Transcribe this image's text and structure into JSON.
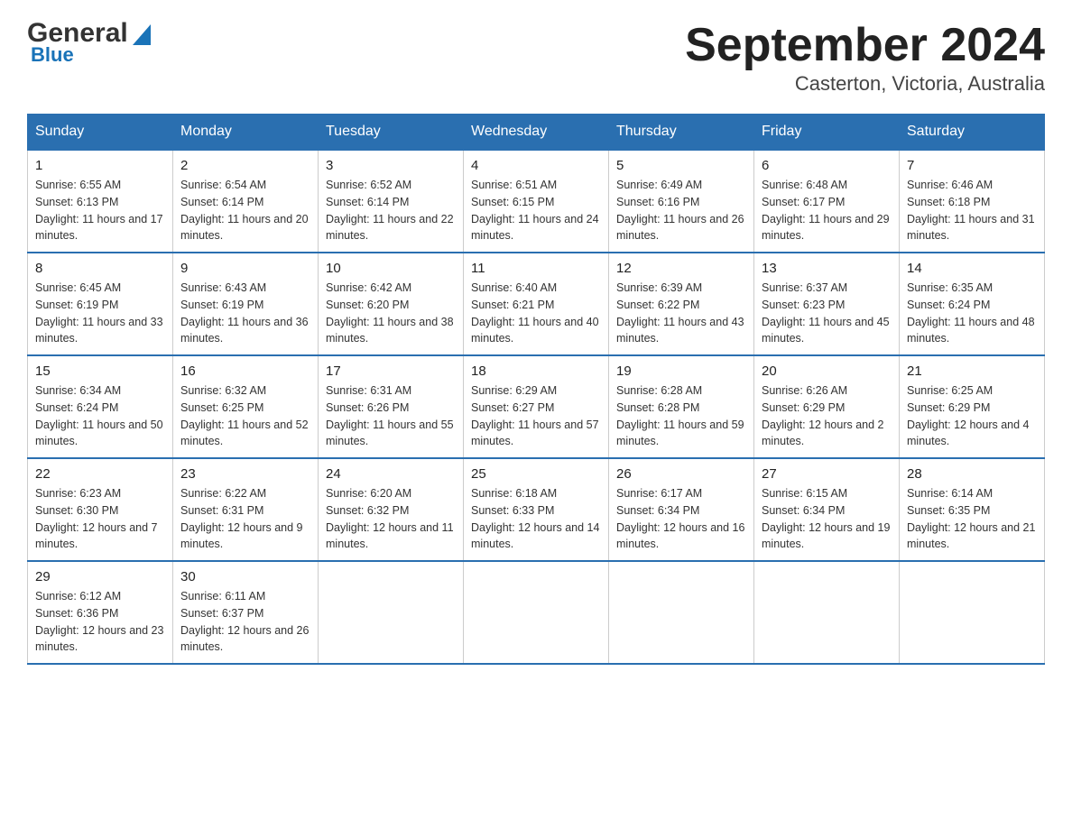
{
  "header": {
    "logo_general": "General",
    "logo_blue": "Blue",
    "title": "September 2024",
    "subtitle": "Casterton, Victoria, Australia"
  },
  "days_of_week": [
    "Sunday",
    "Monday",
    "Tuesday",
    "Wednesday",
    "Thursday",
    "Friday",
    "Saturday"
  ],
  "weeks": [
    [
      {
        "day": "1",
        "sunrise": "Sunrise: 6:55 AM",
        "sunset": "Sunset: 6:13 PM",
        "daylight": "Daylight: 11 hours and 17 minutes."
      },
      {
        "day": "2",
        "sunrise": "Sunrise: 6:54 AM",
        "sunset": "Sunset: 6:14 PM",
        "daylight": "Daylight: 11 hours and 20 minutes."
      },
      {
        "day": "3",
        "sunrise": "Sunrise: 6:52 AM",
        "sunset": "Sunset: 6:14 PM",
        "daylight": "Daylight: 11 hours and 22 minutes."
      },
      {
        "day": "4",
        "sunrise": "Sunrise: 6:51 AM",
        "sunset": "Sunset: 6:15 PM",
        "daylight": "Daylight: 11 hours and 24 minutes."
      },
      {
        "day": "5",
        "sunrise": "Sunrise: 6:49 AM",
        "sunset": "Sunset: 6:16 PM",
        "daylight": "Daylight: 11 hours and 26 minutes."
      },
      {
        "day": "6",
        "sunrise": "Sunrise: 6:48 AM",
        "sunset": "Sunset: 6:17 PM",
        "daylight": "Daylight: 11 hours and 29 minutes."
      },
      {
        "day": "7",
        "sunrise": "Sunrise: 6:46 AM",
        "sunset": "Sunset: 6:18 PM",
        "daylight": "Daylight: 11 hours and 31 minutes."
      }
    ],
    [
      {
        "day": "8",
        "sunrise": "Sunrise: 6:45 AM",
        "sunset": "Sunset: 6:19 PM",
        "daylight": "Daylight: 11 hours and 33 minutes."
      },
      {
        "day": "9",
        "sunrise": "Sunrise: 6:43 AM",
        "sunset": "Sunset: 6:19 PM",
        "daylight": "Daylight: 11 hours and 36 minutes."
      },
      {
        "day": "10",
        "sunrise": "Sunrise: 6:42 AM",
        "sunset": "Sunset: 6:20 PM",
        "daylight": "Daylight: 11 hours and 38 minutes."
      },
      {
        "day": "11",
        "sunrise": "Sunrise: 6:40 AM",
        "sunset": "Sunset: 6:21 PM",
        "daylight": "Daylight: 11 hours and 40 minutes."
      },
      {
        "day": "12",
        "sunrise": "Sunrise: 6:39 AM",
        "sunset": "Sunset: 6:22 PM",
        "daylight": "Daylight: 11 hours and 43 minutes."
      },
      {
        "day": "13",
        "sunrise": "Sunrise: 6:37 AM",
        "sunset": "Sunset: 6:23 PM",
        "daylight": "Daylight: 11 hours and 45 minutes."
      },
      {
        "day": "14",
        "sunrise": "Sunrise: 6:35 AM",
        "sunset": "Sunset: 6:24 PM",
        "daylight": "Daylight: 11 hours and 48 minutes."
      }
    ],
    [
      {
        "day": "15",
        "sunrise": "Sunrise: 6:34 AM",
        "sunset": "Sunset: 6:24 PM",
        "daylight": "Daylight: 11 hours and 50 minutes."
      },
      {
        "day": "16",
        "sunrise": "Sunrise: 6:32 AM",
        "sunset": "Sunset: 6:25 PM",
        "daylight": "Daylight: 11 hours and 52 minutes."
      },
      {
        "day": "17",
        "sunrise": "Sunrise: 6:31 AM",
        "sunset": "Sunset: 6:26 PM",
        "daylight": "Daylight: 11 hours and 55 minutes."
      },
      {
        "day": "18",
        "sunrise": "Sunrise: 6:29 AM",
        "sunset": "Sunset: 6:27 PM",
        "daylight": "Daylight: 11 hours and 57 minutes."
      },
      {
        "day": "19",
        "sunrise": "Sunrise: 6:28 AM",
        "sunset": "Sunset: 6:28 PM",
        "daylight": "Daylight: 11 hours and 59 minutes."
      },
      {
        "day": "20",
        "sunrise": "Sunrise: 6:26 AM",
        "sunset": "Sunset: 6:29 PM",
        "daylight": "Daylight: 12 hours and 2 minutes."
      },
      {
        "day": "21",
        "sunrise": "Sunrise: 6:25 AM",
        "sunset": "Sunset: 6:29 PM",
        "daylight": "Daylight: 12 hours and 4 minutes."
      }
    ],
    [
      {
        "day": "22",
        "sunrise": "Sunrise: 6:23 AM",
        "sunset": "Sunset: 6:30 PM",
        "daylight": "Daylight: 12 hours and 7 minutes."
      },
      {
        "day": "23",
        "sunrise": "Sunrise: 6:22 AM",
        "sunset": "Sunset: 6:31 PM",
        "daylight": "Daylight: 12 hours and 9 minutes."
      },
      {
        "day": "24",
        "sunrise": "Sunrise: 6:20 AM",
        "sunset": "Sunset: 6:32 PM",
        "daylight": "Daylight: 12 hours and 11 minutes."
      },
      {
        "day": "25",
        "sunrise": "Sunrise: 6:18 AM",
        "sunset": "Sunset: 6:33 PM",
        "daylight": "Daylight: 12 hours and 14 minutes."
      },
      {
        "day": "26",
        "sunrise": "Sunrise: 6:17 AM",
        "sunset": "Sunset: 6:34 PM",
        "daylight": "Daylight: 12 hours and 16 minutes."
      },
      {
        "day": "27",
        "sunrise": "Sunrise: 6:15 AM",
        "sunset": "Sunset: 6:34 PM",
        "daylight": "Daylight: 12 hours and 19 minutes."
      },
      {
        "day": "28",
        "sunrise": "Sunrise: 6:14 AM",
        "sunset": "Sunset: 6:35 PM",
        "daylight": "Daylight: 12 hours and 21 minutes."
      }
    ],
    [
      {
        "day": "29",
        "sunrise": "Sunrise: 6:12 AM",
        "sunset": "Sunset: 6:36 PM",
        "daylight": "Daylight: 12 hours and 23 minutes."
      },
      {
        "day": "30",
        "sunrise": "Sunrise: 6:11 AM",
        "sunset": "Sunset: 6:37 PM",
        "daylight": "Daylight: 12 hours and 26 minutes."
      },
      {
        "day": "",
        "sunrise": "",
        "sunset": "",
        "daylight": ""
      },
      {
        "day": "",
        "sunrise": "",
        "sunset": "",
        "daylight": ""
      },
      {
        "day": "",
        "sunrise": "",
        "sunset": "",
        "daylight": ""
      },
      {
        "day": "",
        "sunrise": "",
        "sunset": "",
        "daylight": ""
      },
      {
        "day": "",
        "sunrise": "",
        "sunset": "",
        "daylight": ""
      }
    ]
  ]
}
